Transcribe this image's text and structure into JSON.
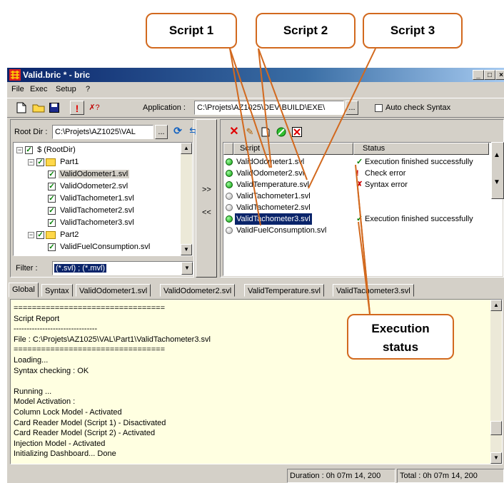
{
  "callouts": {
    "script1": "Script 1",
    "script2": "Script 2",
    "script3": "Script 3",
    "execution_status_line1": "Execution",
    "execution_status_line2": "status"
  },
  "window": {
    "title": "Valid.bric * - bric",
    "controls": [
      "_",
      "□",
      "×"
    ]
  },
  "menu": [
    "File",
    "Exec",
    "Setup",
    "?"
  ],
  "toolbar": {
    "application_label": "Application :",
    "application_value": "C:\\Projets\\AZ1025\\DEV\\BUILD\\EXE\\",
    "browse_label": "...",
    "auto_check_label": "Auto check Syntax"
  },
  "left_panel": {
    "root_dir_label": "Root Dir :",
    "root_dir_value": "C:\\Projets\\AZ1025\\VAL",
    "root_browse": "...",
    "tree": [
      {
        "label": "$ (RootDir)",
        "level": 0,
        "type": "root"
      },
      {
        "label": "Part1",
        "level": 1,
        "type": "folder"
      },
      {
        "label": "ValidOdometer1.svl",
        "level": 2,
        "type": "file",
        "selected": true
      },
      {
        "label": "ValidOdometer2.svl",
        "level": 2,
        "type": "file"
      },
      {
        "label": "ValidTachometer1.svl",
        "level": 2,
        "type": "file"
      },
      {
        "label": "ValidTachometer2.svl",
        "level": 2,
        "type": "file"
      },
      {
        "label": "ValidTachometer3.svl",
        "level": 2,
        "type": "file"
      },
      {
        "label": "Part2",
        "level": 1,
        "type": "folder"
      },
      {
        "label": "ValidFuelConsumption.svl",
        "level": 2,
        "type": "file"
      }
    ],
    "filter_label": "Filter :",
    "filter_value": "(*.svl) ; (*.mvl)"
  },
  "move_buttons": {
    "add": ">>",
    "remove": "<<"
  },
  "script_list": {
    "col_script": "Script",
    "col_status": "Status",
    "rows": [
      {
        "name": "ValidOdometer1.svl",
        "dot": "green",
        "status_icon": "✓",
        "status_color": "#008000",
        "status": "Execution finished successfully"
      },
      {
        "name": "ValidOdometer2.svl",
        "dot": "green",
        "status_icon": "!",
        "status_color": "#cc0000",
        "status": "Check error"
      },
      {
        "name": "ValidTemperature.svl",
        "dot": "green",
        "status_icon": "✗",
        "status_color": "#cc0000",
        "status": "Syntax error"
      },
      {
        "name": "ValidTachometer1.svl",
        "dot": "gray",
        "status_icon": "",
        "status_color": "#000000",
        "status": ""
      },
      {
        "name": "ValidTachometer2.svl",
        "dot": "gray",
        "status_icon": "",
        "status_color": "#000000",
        "status": ""
      },
      {
        "name": "ValidTachometer3.svl",
        "dot": "green",
        "status_icon": "✓",
        "status_color": "#008000",
        "status": "Execution finished successfully",
        "selected": true
      },
      {
        "name": "ValidFuelConsumption.svl",
        "dot": "gray",
        "status_icon": "",
        "status_color": "#000000",
        "status": ""
      }
    ]
  },
  "tabs": [
    "Global",
    "Syntax",
    "ValidOdometer1.svl",
    "ValidOdometer2.svl",
    "ValidTemperature.svl",
    "ValidTachometer3.svl"
  ],
  "log": [
    "=================================",
    "Script Report",
    "--------------------------------",
    "File : C:\\Projets\\AZ1025\\VAL\\Part1\\ValidTachometer3.svl",
    "=================================",
    "Loading...",
    "Syntax checking : OK",
    "",
    "Running ...",
    "Model Activation :",
    "Column Lock Model - Activated",
    "Card Reader Model (Script 1) - Disactivated",
    "Card Reader Model (Script 2) - Activated",
    "Injection Model - Activated",
    "Initializing Dashboard...    Done"
  ],
  "statusbar": {
    "duration": "Duration :   0h 07m 14, 200",
    "total": "Total :   0h 07m 14, 200"
  },
  "colors": {
    "accent": "#d2691e",
    "log_bg": "#ffffe1",
    "selection": "#0a246a"
  }
}
